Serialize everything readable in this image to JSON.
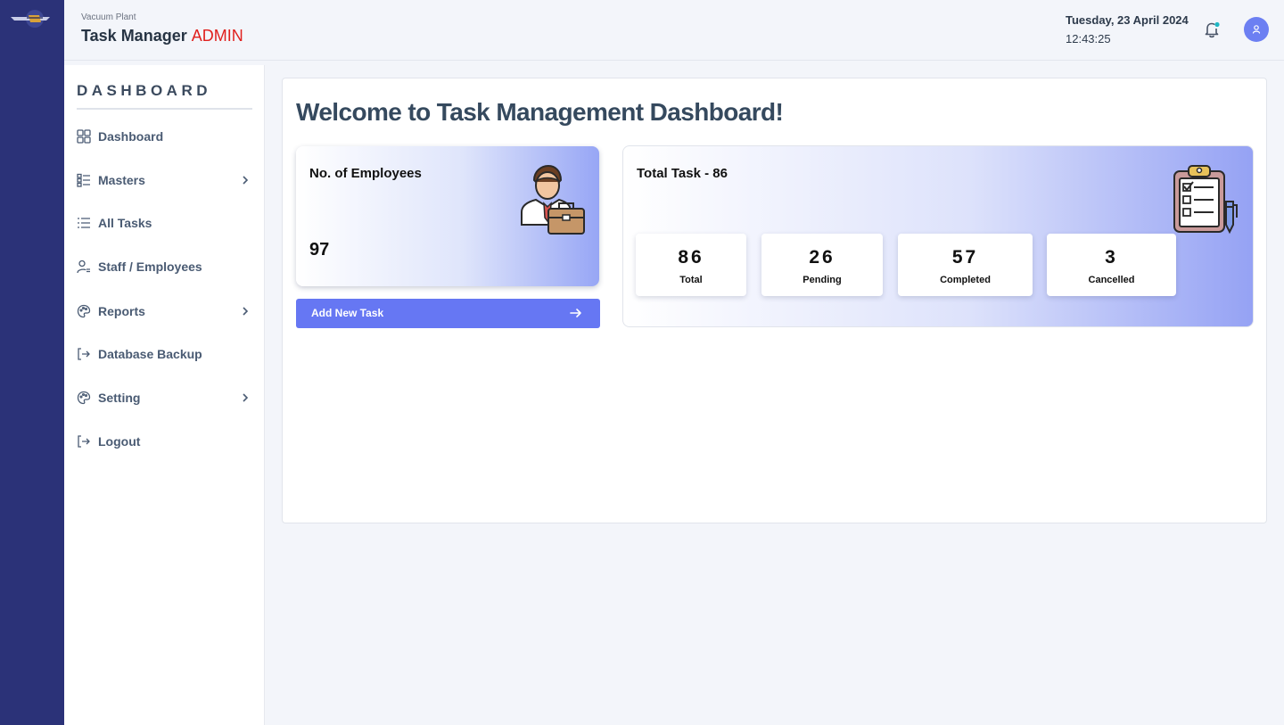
{
  "header": {
    "org_name": "Vacuum Plant",
    "app_title": "Task Manager",
    "role": "ADMIN",
    "date": "Tuesday, 23 April 2024",
    "time": "12:43:25",
    "icons": [
      "company-logo-icon",
      "bell-icon",
      "user-avatar-icon"
    ]
  },
  "sidebar": {
    "title": "DASHBOARD",
    "items": [
      {
        "label": "Dashboard",
        "icon": "grid-icon",
        "has_submenu": false
      },
      {
        "label": "Masters",
        "icon": "list-check-icon",
        "has_submenu": true
      },
      {
        "label": "All Tasks",
        "icon": "list-icon",
        "has_submenu": false
      },
      {
        "label": "Staff / Employees",
        "icon": "user-list-icon",
        "has_submenu": false
      },
      {
        "label": "Reports",
        "icon": "palette-icon",
        "has_submenu": true
      },
      {
        "label": "Database Backup",
        "icon": "sign-out-icon",
        "has_submenu": false
      },
      {
        "label": "Setting",
        "icon": "palette-icon",
        "has_submenu": true
      },
      {
        "label": "Logout",
        "icon": "sign-out-icon",
        "has_submenu": false
      }
    ]
  },
  "main": {
    "welcome": "Welcome to Task Management Dashboard!",
    "employees": {
      "title": "No. of Employees",
      "value": "97"
    },
    "add_task_label": "Add New Task",
    "tasks": {
      "title": "Total Task - 86",
      "stats": [
        {
          "value": "86",
          "label": "Total"
        },
        {
          "value": "26",
          "label": "Pending"
        },
        {
          "value": "57",
          "label": "Completed"
        },
        {
          "value": "3",
          "label": "Cancelled"
        }
      ]
    }
  },
  "colors": {
    "rail": "#2b3278",
    "accent": "#6677f3",
    "role": "#e0201e",
    "notification_dot": "#1fb7c4"
  }
}
